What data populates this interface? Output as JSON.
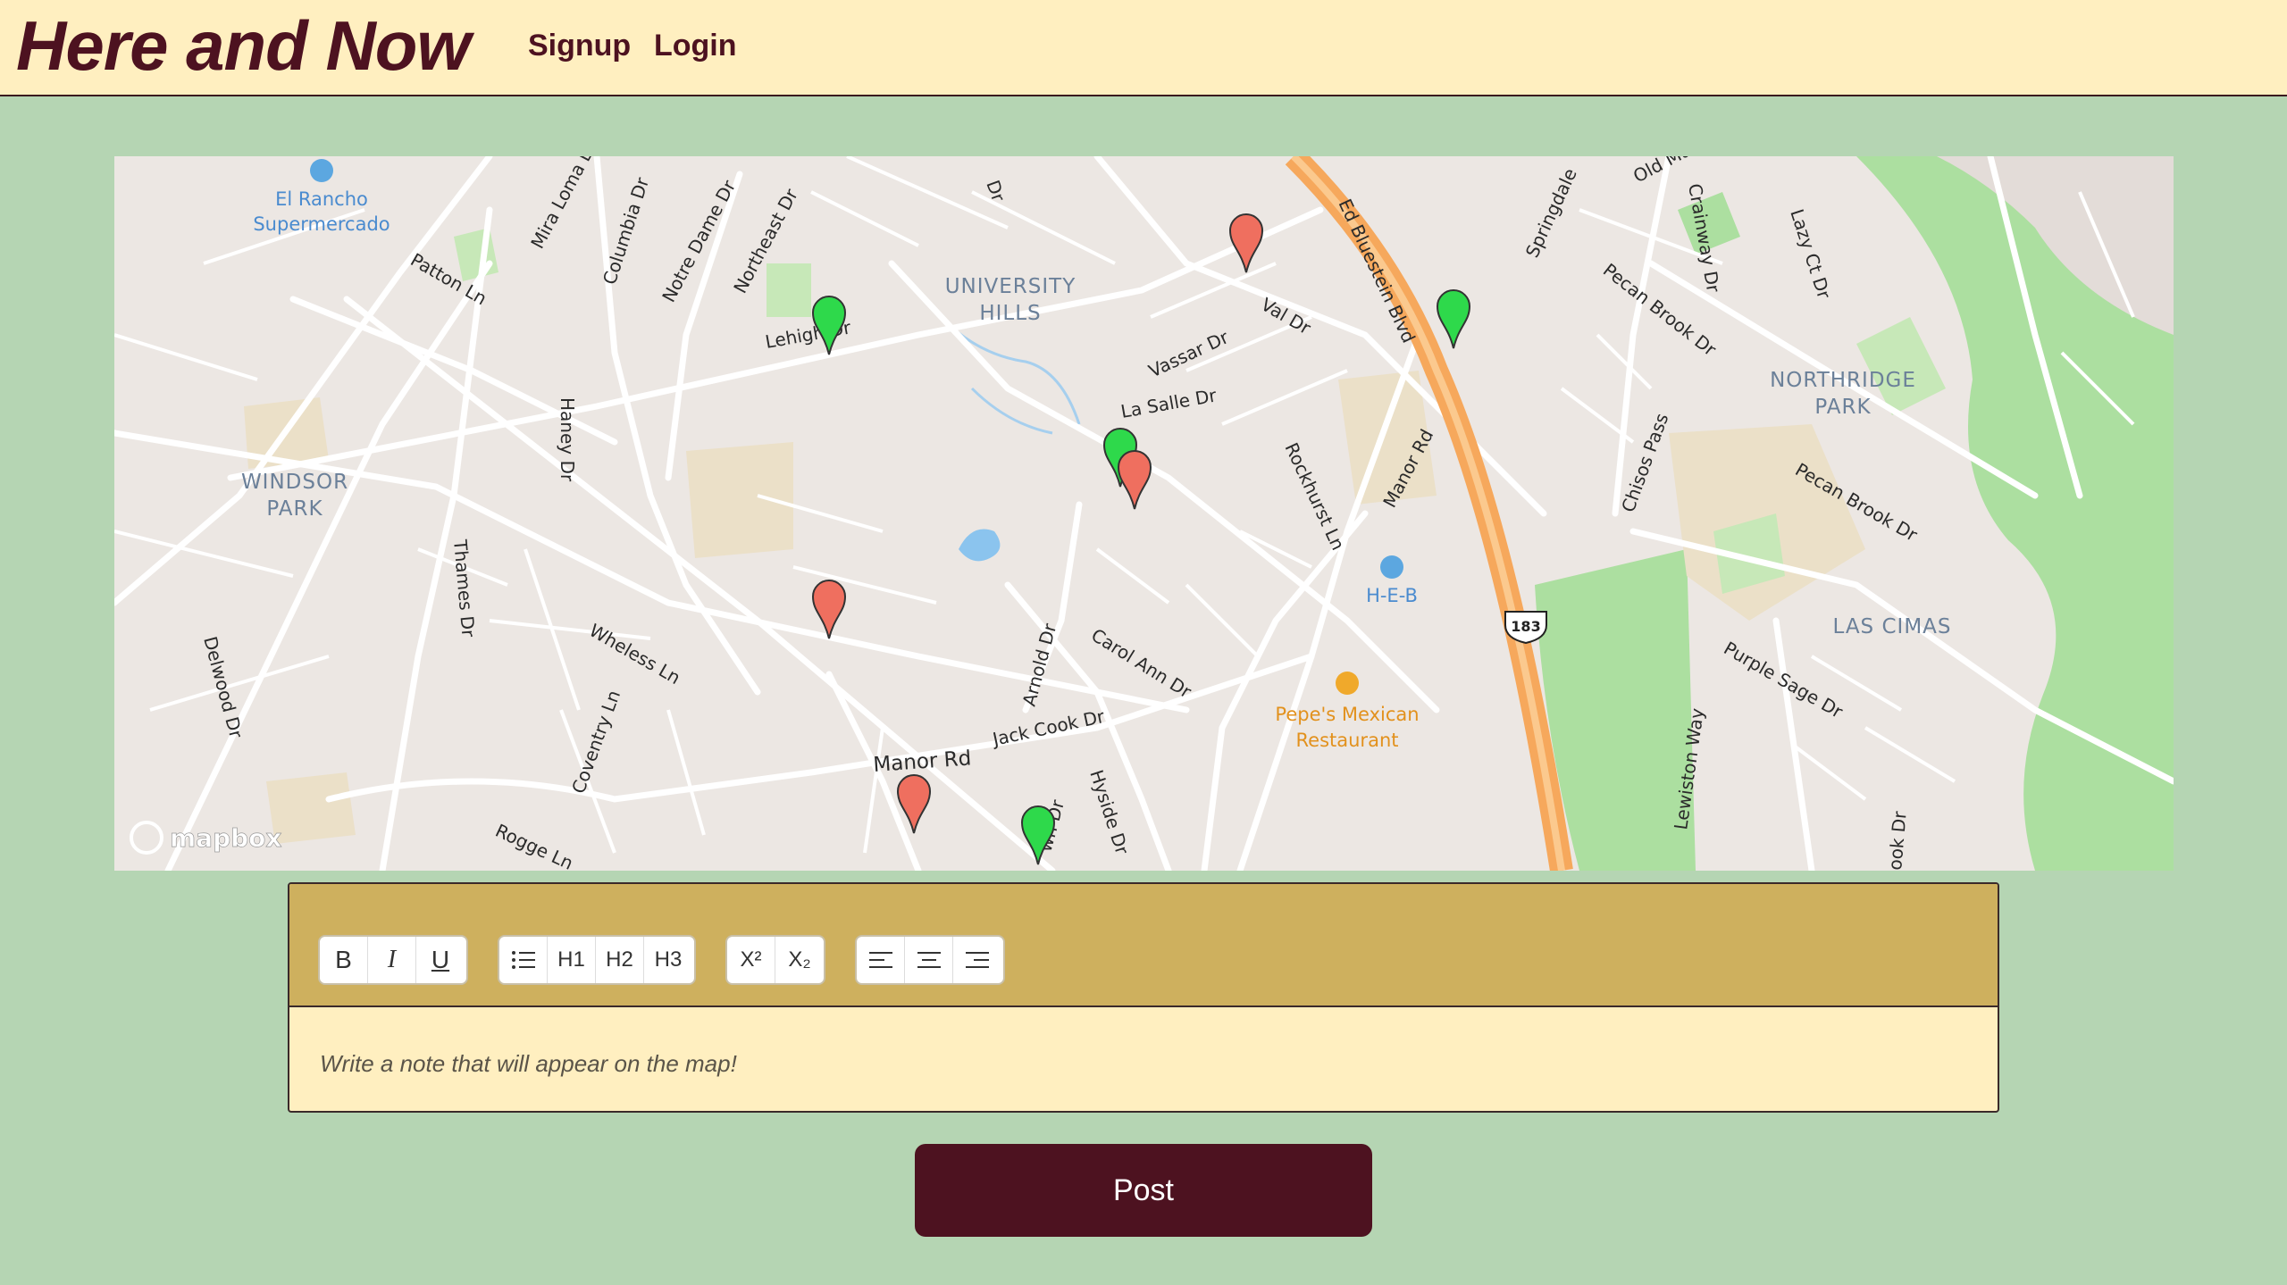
{
  "header": {
    "brand": "Here and Now",
    "nav": {
      "signup": "Signup",
      "login": "Login"
    }
  },
  "map": {
    "attribution": "mapbox",
    "areas": [
      "UNIVERSITY",
      "HILLS",
      "WINDSOR",
      "PARK",
      "NORTHRIDGE",
      "PARK",
      "LAS CIMAS"
    ],
    "pois": {
      "el_rancho": [
        "El Rancho",
        "Supermercado"
      ],
      "heb": "H-E-B",
      "pepes": [
        "Pepe's Mexican",
        "Restaurant"
      ],
      "route": "183"
    },
    "streets": {
      "patton": "Patton Ln",
      "mira_loma": "Mira Loma Ln",
      "columbia": "Columbia Dr",
      "notre_dame": "Notre Dame Dr",
      "northeast": "Northeast Dr",
      "lehigh": "Lehigh Dr",
      "dr_top": "Dr",
      "val": "Val Dr",
      "vassar": "Vassar Dr",
      "la_salle": "La Salle Dr",
      "ed_bluestein": "Ed Bluestein Blvd",
      "springdale": "Springdale",
      "old_manor": "Old Ma",
      "crainway": "Crainway Dr",
      "lazy_ct": "Lazy Ct Dr",
      "pecan_brook_1": "Pecan Brook Dr",
      "pecan_brook_2": "Pecan Brook Dr",
      "haney": "Haney Dr",
      "thames": "Thames Dr",
      "delwood": "Delwood Dr",
      "wheless": "Wheless Ln",
      "coventry": "Coventry Ln",
      "rogge": "Rogge Ln",
      "rockhurst": "Rockhurst Ln",
      "manor_rd_1": "Manor Rd",
      "manor_rd_2": "Manor Rd",
      "chisos": "Chisos Pass",
      "carol_ann": "Carol Ann Dr",
      "arnold": "Arnold Dr",
      "jack_cook": "Jack Cook Dr",
      "hyside": "Hyside Dr",
      "lawn": "wn Dr",
      "purple_sage": "Purple Sage Dr",
      "lewiston": "Lewiston Way",
      "ook": "ook Dr"
    },
    "markers": [
      {
        "color": "red"
      },
      {
        "color": "green"
      },
      {
        "color": "green"
      },
      {
        "color": "green"
      },
      {
        "color": "red"
      },
      {
        "color": "red"
      },
      {
        "color": "red"
      },
      {
        "color": "green"
      }
    ]
  },
  "editor": {
    "toolbar": {
      "bold": "B",
      "italic": "I",
      "underline": "U",
      "list": "list-icon",
      "h1": "H1",
      "h2": "H2",
      "h3": "H3",
      "superscript": "X²",
      "subscript": "X₂",
      "align_left": "align-left-icon",
      "align_center": "align-center-icon",
      "align_right": "align-right-icon"
    },
    "placeholder": "Write a note that will appear on the map!"
  },
  "post_button": "Post",
  "colors": {
    "page_bg": "#b5d5b3",
    "header_bg": "#ffefc0",
    "brand": "#4d1220",
    "toolbar_bg": "#ceb05e",
    "button_bg": "#4d1220",
    "marker_red": "#ef6f5f",
    "marker_green": "#2ed94b"
  }
}
